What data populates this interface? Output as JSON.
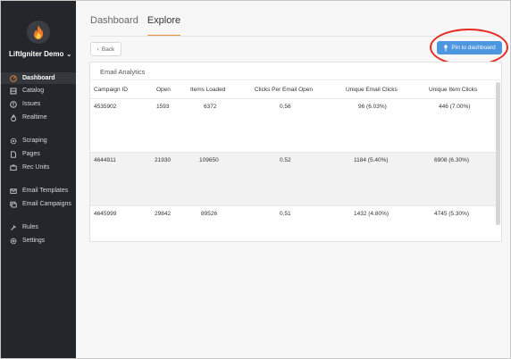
{
  "sidebar": {
    "org_name": "LiftIgniter Demo",
    "items": [
      {
        "label": "Dashboard",
        "icon": "gauge-icon"
      },
      {
        "label": "Catalog",
        "icon": "catalog-icon"
      },
      {
        "label": "Issues",
        "icon": "alert-icon"
      },
      {
        "label": "Realtime",
        "icon": "flame-icon"
      },
      {
        "label": "Scraping",
        "icon": "gear-icon"
      },
      {
        "label": "Pages",
        "icon": "pages-icon"
      },
      {
        "label": "Rec Units",
        "icon": "units-icon"
      },
      {
        "label": "Email Templates",
        "icon": "envelope-icon"
      },
      {
        "label": "Email Campaigns",
        "icon": "campaigns-icon"
      },
      {
        "label": "Rules",
        "icon": "rules-icon"
      },
      {
        "label": "Settings",
        "icon": "settings-icon"
      }
    ]
  },
  "tabs": [
    {
      "label": "Dashboard"
    },
    {
      "label": "Explore"
    }
  ],
  "back_label": "Back",
  "pin_label": "Pin to dashboard",
  "colors": {
    "accent": "#e8913a",
    "pin_button": "#4c97df",
    "annotation_circle": "#e42c24",
    "sidebar_bg": "#23262b"
  },
  "card": {
    "title": "Email Analytics",
    "columns": [
      "Campaign ID",
      "Open",
      "Items Loaded",
      "Clicks Per Email Open",
      "Unique Email Clicks",
      "Unique Item Clicks"
    ],
    "rows": [
      [
        "4535902",
        "1593",
        "6372",
        "0.56",
        "96 (6.03%)",
        "446 (7.00%)"
      ],
      [
        "4644911",
        "21930",
        "109650",
        "0.52",
        "1184 (5.40%)",
        "6908 (6.30%)"
      ],
      [
        "4645999",
        "29842",
        "89526",
        "0.51",
        "1432 (4.80%)",
        "4745 (5.30%)"
      ]
    ]
  }
}
